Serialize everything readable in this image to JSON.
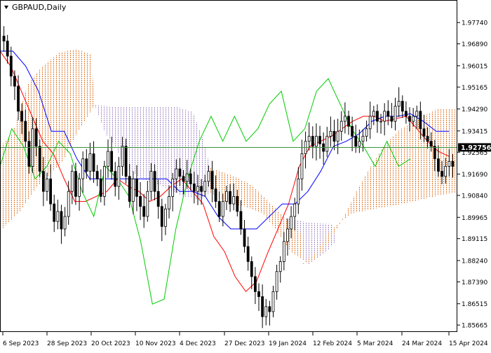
{
  "header": {
    "title": "GBPAUD,Daily"
  },
  "chart_data": {
    "type": "candlestick",
    "symbol": "GBPAUD",
    "timeframe": "Daily",
    "indicator": "Ichimoku Kinko Hyo",
    "current_price": 1.92756,
    "current_price_label": "1.92756",
    "ylim": [
      1.855,
      1.985
    ],
    "y_ticks": [
      1.9774,
      1.9689,
      1.96015,
      1.95165,
      1.9429,
      1.93415,
      1.92565,
      1.9169,
      1.9084,
      1.89965,
      1.89115,
      1.8824,
      1.8739,
      1.86515,
      1.85665
    ],
    "y_tick_labels": [
      "1.97740",
      "1.96890",
      "1.96015",
      "1.95165",
      "1.94290",
      "1.93415",
      "1.92565",
      "1.91690",
      "1.90840",
      "1.89965",
      "1.89115",
      "1.88240",
      "1.87390",
      "1.86515",
      "1.85665"
    ],
    "x_tick_labels": [
      "6 Sep 2023",
      "28 Sep 2023",
      "20 Oct 2023",
      "10 Nov 2023",
      "4 Dec 2023",
      "27 Dec 2023",
      "19 Jan 2024",
      "12 Feb 2024",
      "5 Mar 2024",
      "24 Mar 2024",
      "15 Apr 2024"
    ],
    "close": [
      1.97,
      1.964,
      1.956,
      1.952,
      1.942,
      1.938,
      1.93,
      1.92,
      1.935,
      1.928,
      1.918,
      1.91,
      1.915,
      1.905,
      1.898,
      1.902,
      1.895,
      1.9,
      1.91,
      1.918,
      1.908,
      1.915,
      1.923,
      1.918,
      1.925,
      1.918,
      1.915,
      1.908,
      1.92,
      1.926,
      1.918,
      1.912,
      1.92,
      1.928,
      1.916,
      1.906,
      1.915,
      1.908,
      1.904,
      1.9,
      1.91,
      1.918,
      1.91,
      1.904,
      1.896,
      1.903,
      1.908,
      1.915,
      1.919,
      1.916,
      1.914,
      1.917,
      1.913,
      1.91,
      1.912,
      1.91,
      1.914,
      1.918,
      1.911,
      1.906,
      1.9,
      1.906,
      1.91,
      1.905,
      1.908,
      1.902,
      1.895,
      1.888,
      1.882,
      1.876,
      1.87,
      1.868,
      1.86,
      1.864,
      1.862,
      1.87,
      1.878,
      1.882,
      1.89,
      1.895,
      1.9,
      1.905,
      1.915,
      1.925,
      1.93,
      1.932,
      1.928,
      1.932,
      1.929,
      1.926,
      1.932,
      1.934,
      1.93,
      1.934,
      1.938,
      1.94,
      1.936,
      1.932,
      1.928,
      1.93,
      1.932,
      1.935,
      1.94,
      1.942,
      1.938,
      1.938,
      1.942,
      1.94,
      1.938,
      1.944,
      1.946,
      1.942,
      1.94,
      1.938,
      1.94,
      1.942,
      1.935,
      1.932,
      1.93,
      1.928,
      1.923,
      1.918,
      1.916,
      1.92,
      1.922,
      1.92
    ],
    "series": [
      {
        "name": "Tenkan-sen",
        "color": "#ff0000",
        "values": [
          1.966,
          1.96,
          1.95,
          1.94,
          1.93,
          1.925,
          1.915,
          1.906,
          1.906,
          1.908,
          1.91,
          1.915,
          1.912,
          1.91,
          1.906,
          1.908,
          1.912,
          1.915,
          1.91,
          1.905,
          1.892,
          1.886,
          1.876,
          1.87,
          1.874,
          1.885,
          1.895,
          1.905,
          1.92,
          1.928,
          1.93,
          1.932,
          1.935,
          1.938,
          1.94,
          1.94,
          1.938,
          1.939,
          1.94,
          1.935,
          1.93,
          1.926,
          1.924
        ]
      },
      {
        "name": "Kijun-sen",
        "color": "#0000ff",
        "values": [
          1.966,
          1.966,
          1.96,
          1.95,
          1.934,
          1.934,
          1.923,
          1.915,
          1.915,
          1.915,
          1.915,
          1.915,
          1.915,
          1.915,
          1.91,
          1.91,
          1.908,
          1.9,
          1.895,
          1.895,
          1.895,
          1.9,
          1.905,
          1.905,
          1.91,
          1.918,
          1.928,
          1.93,
          1.933,
          1.938,
          1.94,
          1.94,
          1.941,
          1.938,
          1.934,
          1.934
        ]
      },
      {
        "name": "Chikou Span",
        "color": "#00cc00",
        "values": [
          1.92,
          1.935,
          1.928,
          1.915,
          1.92,
          1.93,
          1.925,
          1.91,
          1.9,
          1.92,
          1.915,
          1.908,
          1.89,
          1.865,
          1.867,
          1.895,
          1.915,
          1.93,
          1.94,
          1.93,
          1.94,
          1.93,
          1.935,
          1.945,
          1.95,
          1.93,
          1.935,
          1.95,
          1.955,
          1.945,
          1.935,
          1.928,
          1.92,
          1.93,
          1.92,
          1.923
        ]
      }
    ],
    "cloud_colors": {
      "bullish": "#e07b30",
      "bearish": "#a88cc8"
    },
    "grid": false,
    "legend": "none"
  },
  "colors": {
    "background": "#ffffff",
    "axis": "#000000",
    "text": "#000000",
    "price_line": "#3a8f3a",
    "price_label_bg": "#000000",
    "price_label_text": "#ffffff"
  }
}
